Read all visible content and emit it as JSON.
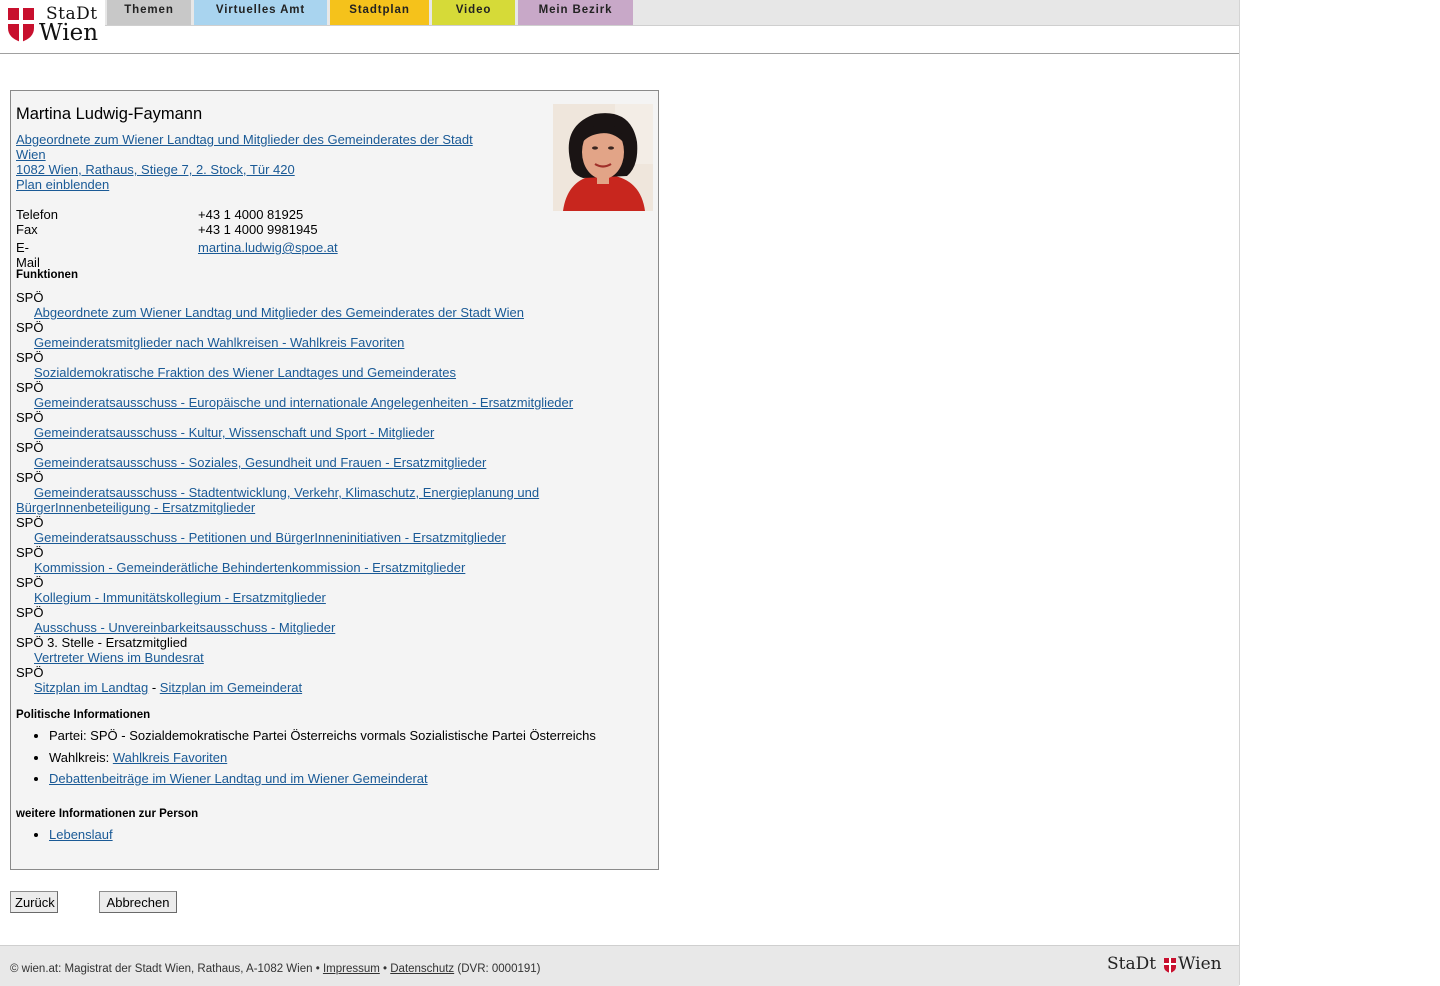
{
  "header": {
    "logo_line1": "StaDt",
    "logo_line2": "Wien",
    "tabs": [
      {
        "label": "Themen",
        "color": "#c8c8c8"
      },
      {
        "label": "Virtuelles Amt",
        "color": "#a9d4ef"
      },
      {
        "label": "Stadtplan",
        "color": "#f5c21b"
      },
      {
        "label": "Video",
        "color": "#d6da38"
      },
      {
        "label": "Mein Bezirk",
        "color": "#c8a8c8"
      }
    ]
  },
  "person": {
    "name": "Martina Ludwig-Faymann",
    "title": "Abgeordnete zum Wiener Landtag und Mitglieder des Gemeinderates der Stadt Wien",
    "address": "1082 Wien, Rathaus, Stiege 7, 2. Stock, Tür 420",
    "plan_link": "Plan einblenden",
    "contact": [
      {
        "label": "Telefon",
        "value": "+43 1 4000 81925"
      },
      {
        "label": "Fax",
        "value": "+43 1 4000 9981945"
      },
      {
        "label": "E-Mail",
        "value": "martina.ludwig@spoe.at"
      }
    ]
  },
  "functions": {
    "heading": "Funktionen",
    "items": [
      {
        "party": "SPÖ",
        "link": "Abgeordnete zum Wiener Landtag und Mitglieder des Gemeinderates der Stadt Wien"
      },
      {
        "party": "SPÖ",
        "link": "Gemeinderatsmitglieder nach Wahlkreisen - Wahlkreis Favoriten"
      },
      {
        "party": "SPÖ",
        "link": "Sozialdemokratische Fraktion des Wiener Landtages und Gemeinderates"
      },
      {
        "party": "SPÖ",
        "link": "Gemeinderatsausschuss - Europäische und internationale Angelegenheiten - Ersatzmitglieder"
      },
      {
        "party": "SPÖ",
        "link": "Gemeinderatsausschuss - Kultur, Wissenschaft und Sport - Mitglieder"
      },
      {
        "party": "SPÖ",
        "link": "Gemeinderatsausschuss - Soziales, Gesundheit und Frauen - Ersatzmitglieder"
      },
      {
        "party": "SPÖ",
        "link": "Gemeinderatsausschuss - Stadtentwicklung, Verkehr, Klimaschutz, Energieplanung und BürgerInnenbeteiligung - Ersatzmitglieder"
      },
      {
        "party": "SPÖ",
        "link": "Gemeinderatsausschuss - Petitionen und BürgerInneninitiativen - Ersatzmitglieder"
      },
      {
        "party": "SPÖ",
        "link": "Kommission - Gemeinderätliche Behindertenkommission - Ersatzmitglieder"
      },
      {
        "party": "SPÖ",
        "link": "Kollegium - Immunitätskollegium - Ersatzmitglieder"
      },
      {
        "party": "SPÖ",
        "link": "Ausschuss - Unvereinbarkeitsausschuss - Mitglieder"
      },
      {
        "party": "SPÖ 3. Stelle - Ersatzmitglied",
        "link": "Vertreter Wiens im Bundesrat"
      }
    ],
    "last_party": "SPÖ",
    "seat_link_1": "Sitzplan im Landtag",
    "seat_sep": "-",
    "seat_link_2": "Sitzplan im Gemeinderat"
  },
  "political": {
    "heading": "Politische Informationen",
    "party_text": "Partei: SPÖ - Sozialdemokratische Partei Österreichs vormals Sozialistische Partei Österreichs",
    "district_label": "Wahlkreis:",
    "district_link": "Wahlkreis Favoriten",
    "debates_link": "Debattenbeiträge im Wiener Landtag und im Wiener Gemeinderat"
  },
  "more": {
    "heading": "weitere Informationen zur Person",
    "cv_link": "Lebenslauf"
  },
  "buttons": {
    "back": "Zurück",
    "cancel": "Abbrechen"
  },
  "footer": {
    "text": "© wien.at: Magistrat der Stadt Wien, Rathaus, A-1082 Wien •",
    "impressum": "Impressum",
    "bullet": "•",
    "datenschutz": "Datenschutz",
    "dvr": "(DVR: 0000191)",
    "logo_left": "StaDt",
    "logo_right": "Wien"
  },
  "colors": {
    "link": "#1a5a96",
    "card_bg": "#f4f4f4",
    "wien_red": "#c8102e"
  }
}
